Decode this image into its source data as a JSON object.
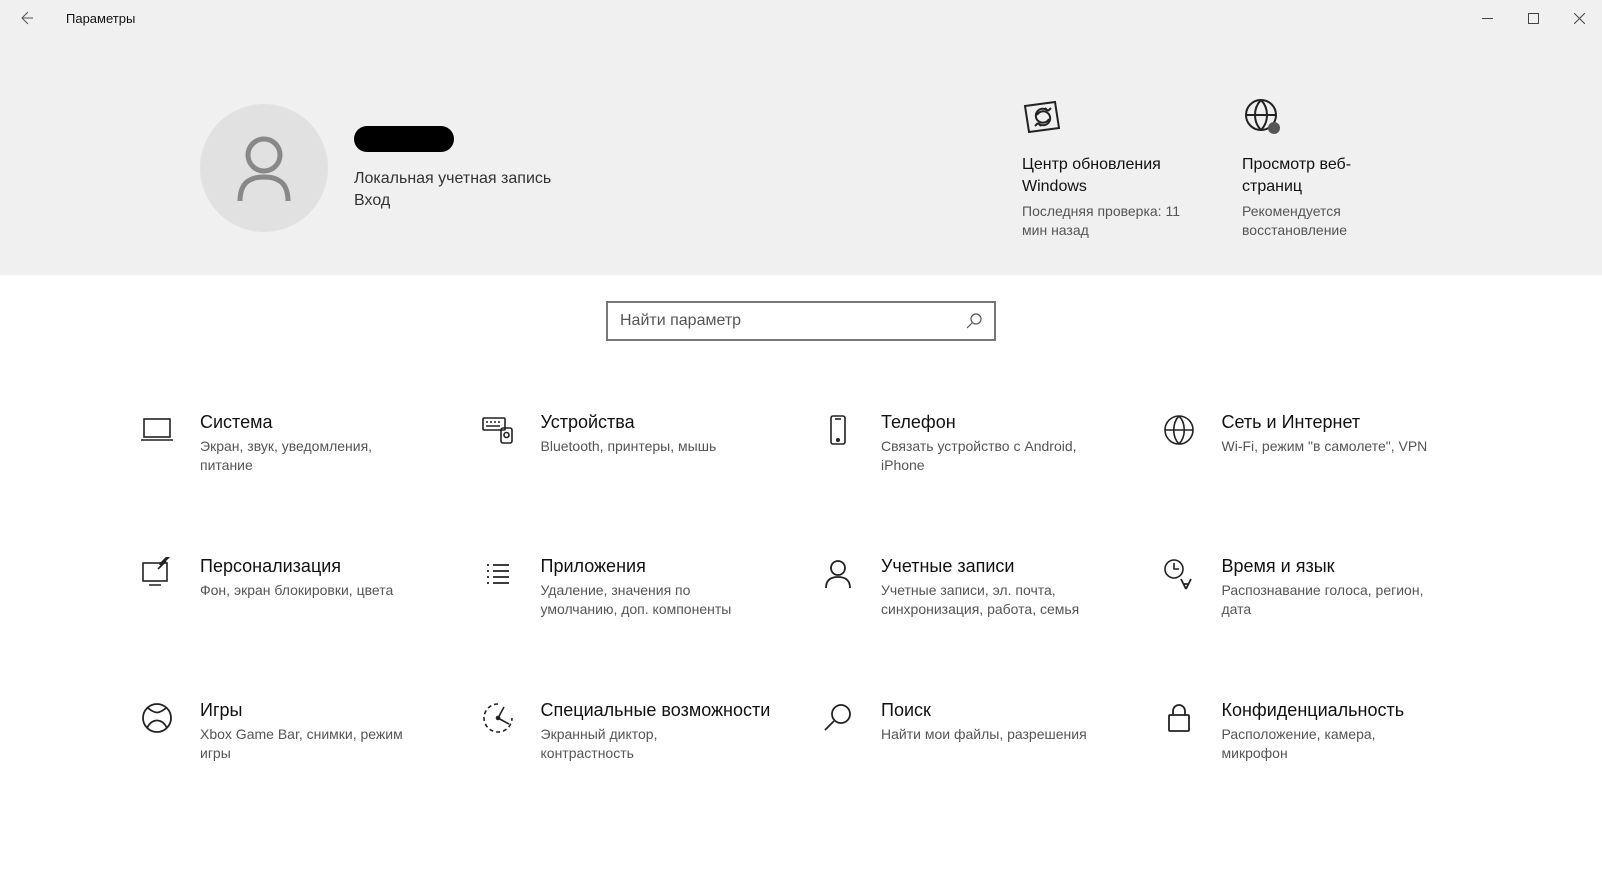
{
  "window": {
    "title": "Параметры"
  },
  "account": {
    "type": "Локальная учетная запись",
    "signin": "Вход"
  },
  "status": {
    "update": {
      "title": "Центр обновления Windows",
      "sub": "Последняя проверка: 11 мин назад"
    },
    "web": {
      "title": "Просмотр веб-страниц",
      "sub": "Рекомендуется восстановление"
    }
  },
  "search": {
    "placeholder": "Найти параметр"
  },
  "tiles": {
    "system": {
      "title": "Система",
      "desc": "Экран, звук, уведомления, питание"
    },
    "devices": {
      "title": "Устройства",
      "desc": "Bluetooth, принтеры, мышь"
    },
    "phone": {
      "title": "Телефон",
      "desc": "Связать устройство с Android, iPhone"
    },
    "network": {
      "title": "Сеть и Интернет",
      "desc": "Wi-Fi, режим \"в самолете\", VPN"
    },
    "personal": {
      "title": "Персонализация",
      "desc": "Фон, экран блокировки, цвета"
    },
    "apps": {
      "title": "Приложения",
      "desc": "Удаление, значения по умолчанию, доп. компоненты"
    },
    "accounts": {
      "title": "Учетные записи",
      "desc": "Учетные записи, эл. почта, синхронизация, работа, семья"
    },
    "time": {
      "title": "Время и язык",
      "desc": "Распознавание голоса, регион, дата"
    },
    "gaming": {
      "title": "Игры",
      "desc": "Xbox Game Bar, снимки, режим игры"
    },
    "access": {
      "title": "Специальные возможности",
      "desc": "Экранный диктор, контрастность"
    },
    "searchcat": {
      "title": "Поиск",
      "desc": "Найти мои файлы, разрешения"
    },
    "privacy": {
      "title": "Конфиденциальность",
      "desc": "Расположение, камера, микрофон"
    }
  }
}
